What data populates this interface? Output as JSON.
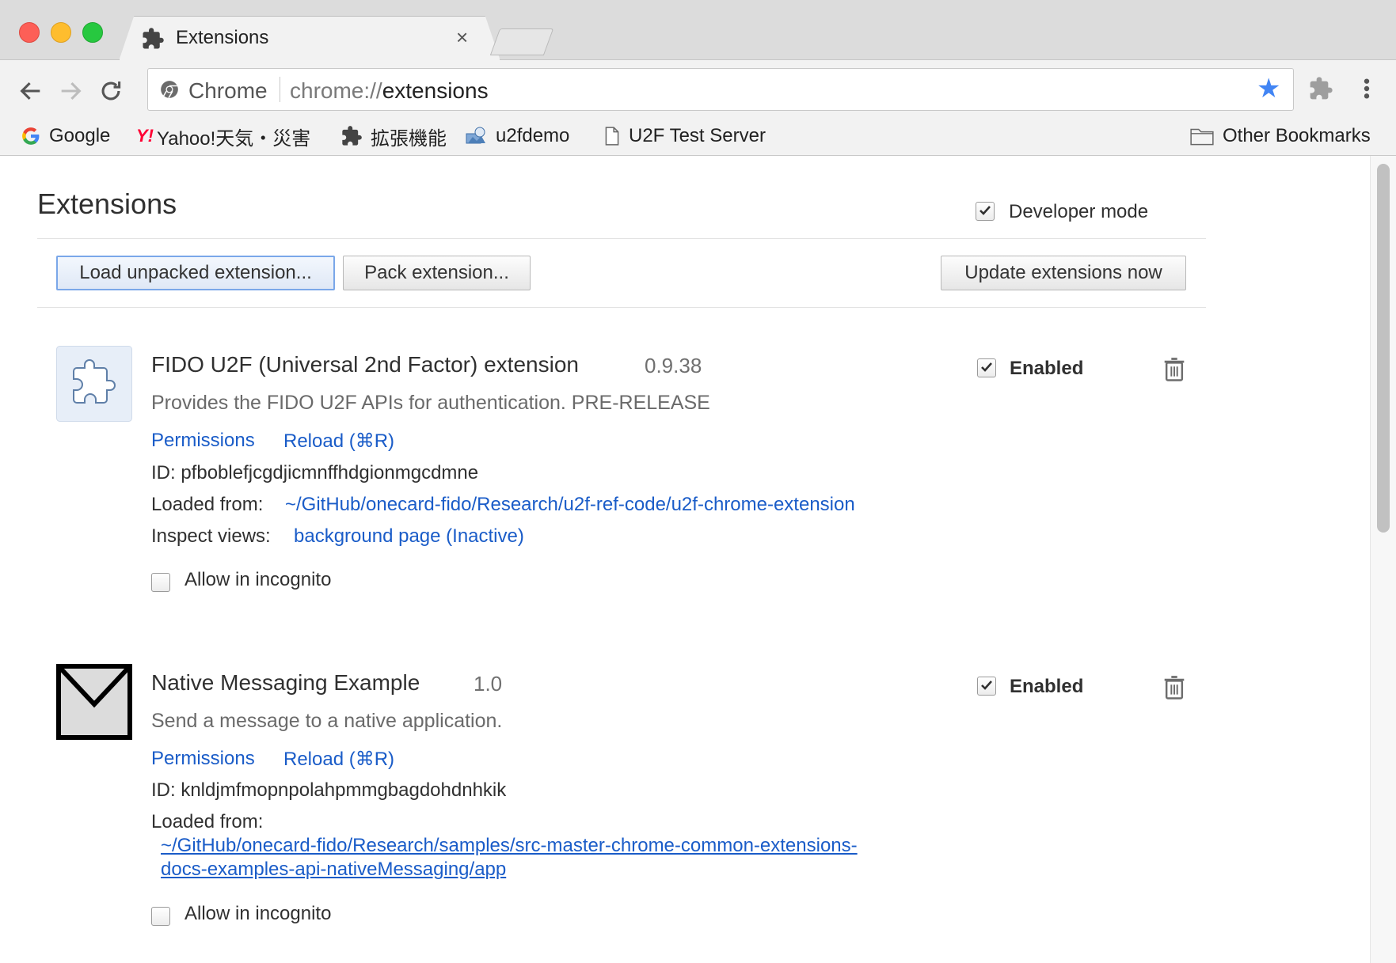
{
  "tab": {
    "title": "Extensions",
    "close": "×"
  },
  "omnibox": {
    "chip_label": "Chrome",
    "url_scheme": "chrome://",
    "url_path": "extensions"
  },
  "bookmarks": {
    "items": [
      {
        "label": "Google",
        "icon": "google-g-icon"
      },
      {
        "label": "Yahoo!天気・災害",
        "icon": "yahoo-icon"
      },
      {
        "label": "拡張機能",
        "icon": "puzzle-icon"
      },
      {
        "label": "u2fdemo",
        "icon": "site-icon"
      },
      {
        "label": "U2F Test Server",
        "icon": "page-icon"
      }
    ],
    "other": "Other Bookmarks"
  },
  "page": {
    "title": "Extensions",
    "developer_mode": {
      "label": "Developer mode",
      "checked": true
    },
    "buttons": {
      "load_unpacked": "Load unpacked extension...",
      "pack": "Pack extension...",
      "update": "Update extensions now"
    }
  },
  "extensions": [
    {
      "name": "FIDO U2F (Universal 2nd Factor) extension",
      "version": "0.9.38",
      "description": "Provides the FIDO U2F APIs for authentication. PRE-RELEASE",
      "permissions": "Permissions",
      "reload": "Reload (⌘R)",
      "id": "ID: pfboblefjcgdjicmnffhdgionmgcdmne",
      "loaded_from_label": "Loaded from:",
      "loaded_from_path": "~/GitHub/onecard-fido/Research/u2f-ref-code/u2f-chrome-extension",
      "inspect_label": "Inspect views:",
      "inspect_link": "background page (Inactive)",
      "incognito": "Allow in incognito",
      "enabled_label": "Enabled",
      "enabled": true,
      "incognito_allowed": false
    },
    {
      "name": "Native Messaging Example",
      "version": "1.0",
      "description": "Send a message to a native application.",
      "permissions": "Permissions",
      "reload": "Reload (⌘R)",
      "id": "ID: knldjmfmopnpolahpmmgbagdohdnhkik",
      "loaded_from_label": "Loaded from:",
      "loaded_from_path_line1": "~/GitHub/onecard-fido/Research/samples/src-master-chrome-common-extensions-",
      "loaded_from_path_line2": "docs-examples-api-nativeMessaging/app",
      "incognito": "Allow in incognito",
      "enabled_label": "Enabled",
      "enabled": true,
      "incognito_allowed": false
    }
  ],
  "colors": {
    "link": "#1a5cc8",
    "star": "#4285f4",
    "focus_border": "#7aa7e9"
  }
}
